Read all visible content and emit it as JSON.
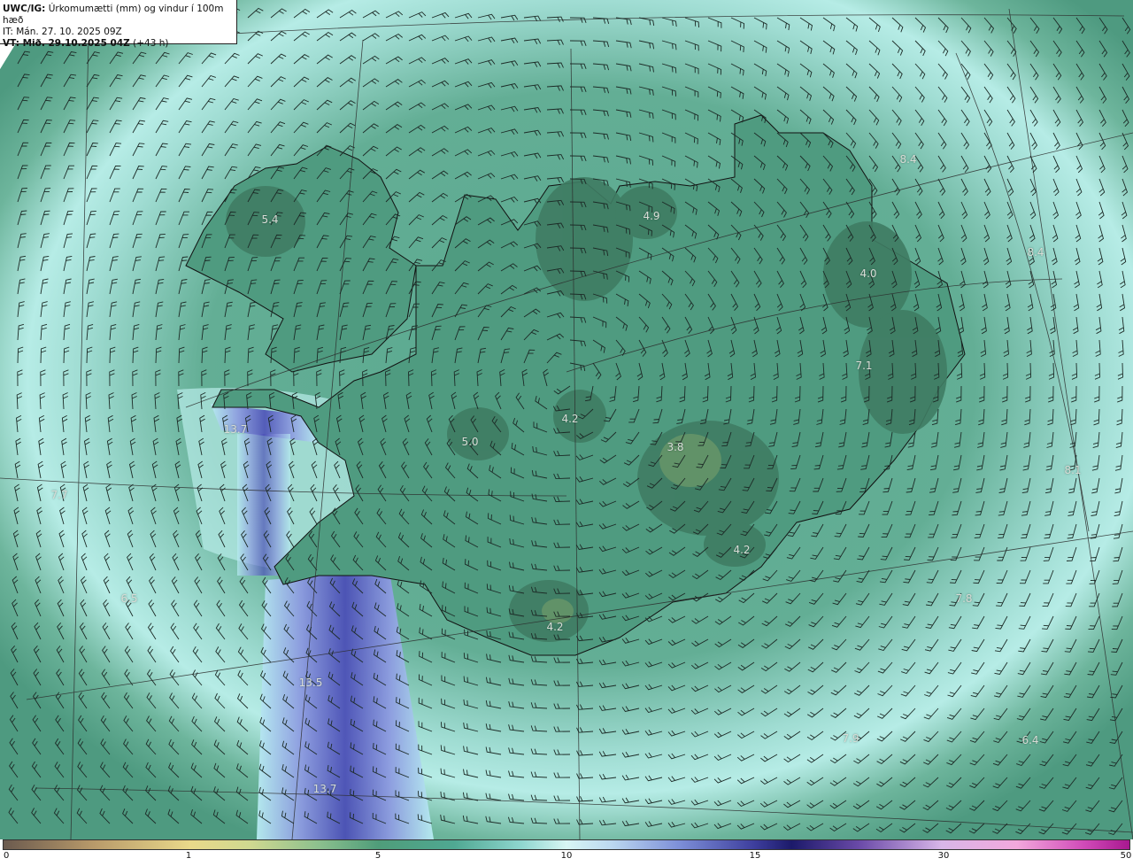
{
  "header": {
    "model_label": "UWC/IG:",
    "title": "Úrkomumætti (mm) og vindur í 100m hæð",
    "it_line": "IT: Mán. 27. 10. 2025 09Z",
    "vt_prefix": "VT: Mið. 29.10.2025 04Z",
    "vt_lead": "(+43 h)"
  },
  "colorbar": {
    "ticks": [
      "0",
      "1",
      "5",
      "10",
      "15",
      "30",
      "50"
    ]
  },
  "value_labels": [
    "5.4",
    "4.9",
    "4.0",
    "7.1",
    "4.2",
    "5.0",
    "3.8",
    "4.2",
    "4.2",
    "7.7",
    "6.5",
    "13.5",
    "13.7",
    "7.8",
    "7.9",
    "6.4",
    "13.7",
    "8.4",
    "8.4",
    "8.1"
  ],
  "colors": {
    "sea_green": "#4e9a85",
    "light_band": "#a8e4dc",
    "heavy_band": "#4a52b8",
    "land_high": "#3f7f63",
    "coast": "#111111"
  }
}
